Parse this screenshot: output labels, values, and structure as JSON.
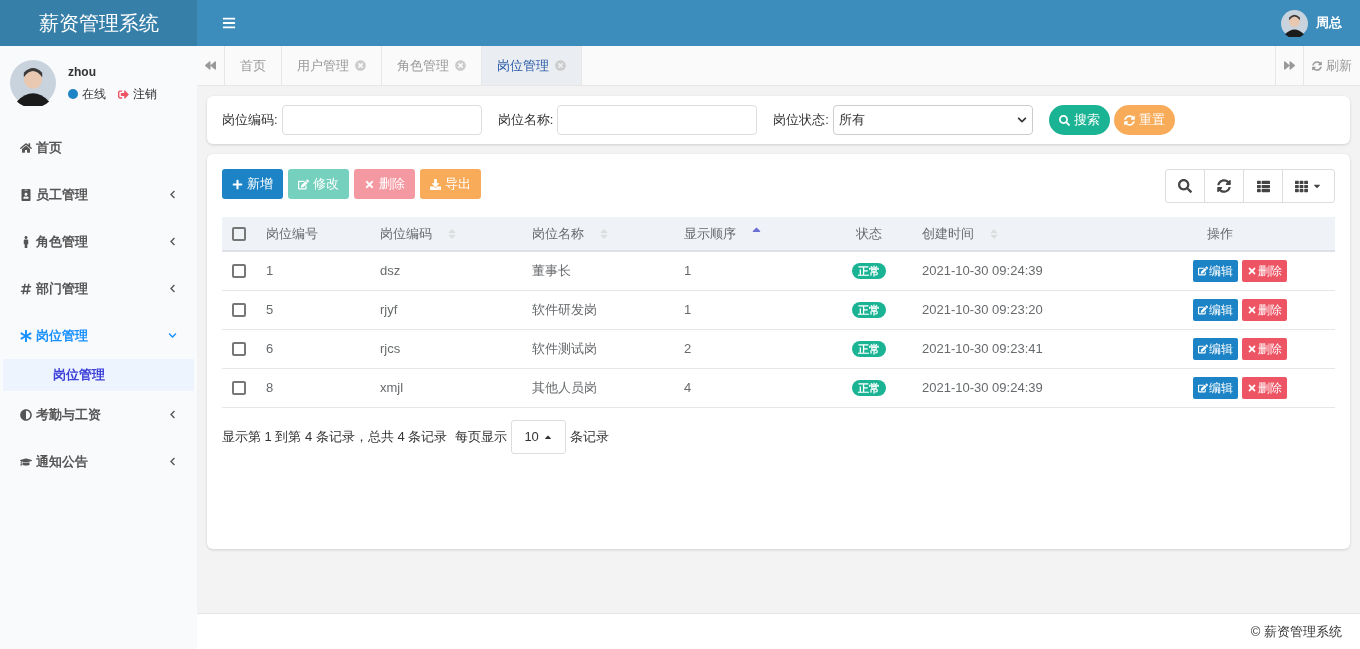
{
  "header": {
    "title": "薪资管理系统",
    "user_name": "周总"
  },
  "profile": {
    "name": "zhou",
    "status": "在线",
    "logout": "注销"
  },
  "sidebar": {
    "items": [
      {
        "label": "首页",
        "kind": "link",
        "expanded": false
      },
      {
        "label": "员工管理",
        "kind": "group",
        "expanded": false
      },
      {
        "label": "角色管理",
        "kind": "group",
        "expanded": false
      },
      {
        "label": "部门管理",
        "kind": "group",
        "expanded": false
      },
      {
        "label": "岗位管理",
        "kind": "group",
        "expanded": true,
        "children": [
          {
            "label": "岗位管理",
            "selected": true
          }
        ]
      },
      {
        "label": "考勤与工资",
        "kind": "group",
        "expanded": false
      },
      {
        "label": "通知公告",
        "kind": "group",
        "expanded": false
      }
    ]
  },
  "tabs": [
    {
      "label": "首页",
      "selected": false,
      "closable": false
    },
    {
      "label": "用户管理",
      "selected": false,
      "closable": true
    },
    {
      "label": "角色管理",
      "selected": false,
      "closable": true
    },
    {
      "label": "岗位管理",
      "selected": true,
      "closable": true
    }
  ],
  "refresh": "刷新",
  "filters": [
    {
      "label": "岗位编码:",
      "kind": "input"
    },
    {
      "label": "岗位名称:",
      "kind": "input"
    },
    {
      "label": "岗位状态:",
      "kind": "select",
      "value": "所有"
    }
  ],
  "filter_buttons": [
    {
      "label": "搜索",
      "kind": "search"
    },
    {
      "label": "重置",
      "kind": "reset"
    }
  ],
  "toolbar": [
    {
      "label": "新增",
      "kind": "add",
      "disabled": false
    },
    {
      "label": "修改",
      "kind": "edit",
      "disabled": true
    },
    {
      "label": "删除",
      "kind": "delete",
      "disabled": true
    },
    {
      "label": "导出",
      "kind": "export",
      "disabled": false
    }
  ],
  "table": {
    "select_all": {
      "checked": false
    },
    "columns": [
      {
        "label": "岗位编号"
      },
      {
        "label": "岗位编码",
        "sorted": false
      },
      {
        "label": "岗位名称",
        "sorted": false
      },
      {
        "label": "显示顺序",
        "sorted": true
      },
      {
        "label": "状态"
      },
      {
        "label": "创建时间",
        "sorted": false
      },
      {
        "label": "操作"
      }
    ],
    "rows": [
      {
        "checked": false,
        "cells": [
          "1",
          "dsz",
          "董事长",
          "1"
        ],
        "status": "正常",
        "created": "2021-10-30 09:24:39",
        "actions": [
          "编辑",
          "删除"
        ]
      },
      {
        "checked": false,
        "cells": [
          "5",
          "rjyf",
          "软件研发岗",
          "1"
        ],
        "status": "正常",
        "created": "2021-10-30 09:23:20",
        "actions": [
          "编辑",
          "删除"
        ]
      },
      {
        "checked": false,
        "cells": [
          "6",
          "rjcs",
          "软件测试岗",
          "2"
        ],
        "status": "正常",
        "created": "2021-10-30 09:23:41",
        "actions": [
          "编辑",
          "删除"
        ]
      },
      {
        "checked": false,
        "cells": [
          "8",
          "xmjl",
          "其他人员岗",
          "4"
        ],
        "status": "正常",
        "created": "2021-10-30 09:24:39",
        "actions": [
          "编辑",
          "删除"
        ]
      }
    ]
  },
  "pagination": {
    "summary": "显示第 1 到第 4 条记录，总共 4 条记录",
    "per_page": "每页显示",
    "page_size": "10",
    "suffix": "条记录"
  },
  "footer": "© 薪资管理系统"
}
